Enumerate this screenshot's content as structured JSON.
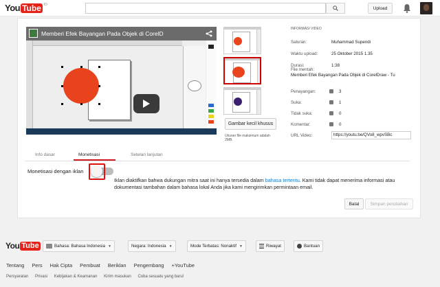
{
  "header": {
    "logo_you": "You",
    "logo_tube": "Tube",
    "region": "ID",
    "search_value": "",
    "upload_label": "Upload"
  },
  "video": {
    "title": "Memberi Efek Bayangan Pada Objek di CorelD"
  },
  "thumbnails": {
    "custom_button": "Gambar kecil khusus",
    "note": "Ukuran file maksimum adalah 2MB."
  },
  "info": {
    "heading": "INFORMASI VIDEO",
    "channel_label": "Saluran:",
    "channel_value": "Muhammad Supendi",
    "upload_time_label": "Waktu upload:",
    "upload_time_value": "25 Oktober 2015 1.35",
    "duration_label": "Durasi:",
    "duration_value": "1:38",
    "file_label": "File mentah:",
    "file_value": "Memberi Efek Bayangan Pada Objek di CorelDraw - Tu",
    "views_label": "Penayangan:",
    "views_value": "3",
    "likes_label": "Suka:",
    "likes_value": "1",
    "dislikes_label": "Tidak suka:",
    "dislikes_value": "0",
    "comments_label": "Komentar:",
    "comments_value": "0",
    "url_label": "URL Video:",
    "url_value": "https://youtu.be/QVo8_wpvSBc"
  },
  "tabs": [
    "Info dasar",
    "Monetisasi",
    "Setelan lanjutan"
  ],
  "monetize": {
    "label": "Monetisasi dengan iklan",
    "text_lead": "Iklan diaktifkan bahwa dukungan mitra saat ini hanya tersedia dalam",
    "text_link": "bahasa tertentu",
    "text_tail": ". Kami tidak dapat menerima informasi atau dokumentasi tambahan dalam bahasa lokal Anda jika kami mengirimkan permintaan email.",
    "toggle_on": false
  },
  "actions": {
    "cancel": "Batal",
    "save": "Simpan perubahan"
  },
  "footer": {
    "language": "Bahasa: Bahasa Indonesia",
    "country": "Negara: Indonesia",
    "restricted": "Mode Terbatas: Nonaktif",
    "history": "Riwayat",
    "help": "Bantuan",
    "links": [
      "Tentang",
      "Pers",
      "Hak Cipta",
      "Pembuat",
      "Beriklan",
      "Pengembang",
      "+YouTube"
    ],
    "links2": [
      "Persyaratan",
      "Privasi",
      "Kebijakan & Keamanan",
      "Kirim masukan",
      "Coba sesuatu yang baru!"
    ]
  },
  "colors": {
    "brand_red": "#e62117",
    "link_blue": "#167ac6",
    "tab_underline": "#cc181e",
    "highlight_red": "#e01010"
  }
}
